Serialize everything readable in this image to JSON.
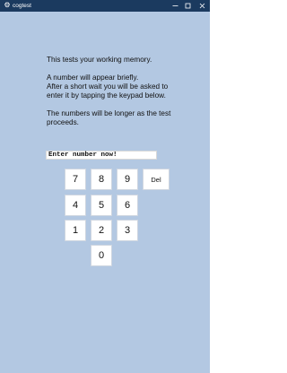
{
  "window": {
    "title": "cogtest",
    "minimize": "–",
    "maximize": "□",
    "close": "✕",
    "title_bar_color": "#1b3a5f",
    "background_color": "#b3c8e2"
  },
  "instructions": {
    "line1": "This tests your working memory.",
    "line2": "A number will appear briefly.",
    "line3": "After a short wait you will be asked to",
    "line4": "enter it by tapping the keypad below.",
    "line5": "The numbers will be longer as the test",
    "line6": "proceeds."
  },
  "entry": {
    "text": "Enter number now!"
  },
  "keypad": {
    "k7": "7",
    "k8": "8",
    "k9": "9",
    "del": "Del",
    "k4": "4",
    "k5": "5",
    "k6": "6",
    "k1": "1",
    "k2": "2",
    "k3": "3",
    "k0": "0"
  }
}
